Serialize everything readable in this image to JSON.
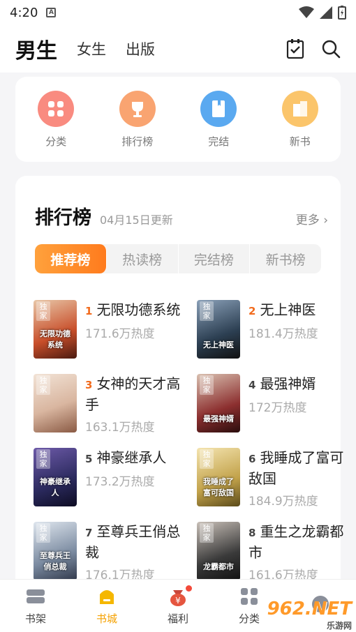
{
  "status_bar": {
    "time": "4:20",
    "notif": "A"
  },
  "header": {
    "tabs": [
      {
        "label": "男生",
        "active": true
      },
      {
        "label": "女生",
        "active": false
      },
      {
        "label": "出版",
        "active": false
      }
    ]
  },
  "categories": [
    {
      "label": "分类",
      "color": "#f98b80"
    },
    {
      "label": "排行榜",
      "color": "#f9a471"
    },
    {
      "label": "完结",
      "color": "#5aa9f0"
    },
    {
      "label": "新书",
      "color": "#fbc56b"
    }
  ],
  "ranking": {
    "title": "排行榜",
    "date": "04月15日更新",
    "more": "更多",
    "tabs": [
      {
        "label": "推荐榜",
        "active": true
      },
      {
        "label": "热读榜",
        "active": false
      },
      {
        "label": "完结榜",
        "active": false
      },
      {
        "label": "新书榜",
        "active": false
      }
    ],
    "books": [
      {
        "rank": "1",
        "name": "无限功德系统",
        "heat": "171.6万热度",
        "cover_tag": "独家",
        "cover_title": "无限功德系统",
        "cover_color": "#c84e2a"
      },
      {
        "rank": "2",
        "name": "无上神医",
        "heat": "181.4万热度",
        "cover_tag": "独家",
        "cover_title": "无上神医",
        "cover_color": "#2c3f52"
      },
      {
        "rank": "3",
        "name": "女神的天才高手",
        "heat": "163.1万热度",
        "cover_tag": "独家",
        "cover_title": "",
        "cover_color": "#d9b6a0"
      },
      {
        "rank": "4",
        "name": "最强神婿",
        "heat": "172万热度",
        "cover_tag": "独家",
        "cover_title": "最强神婿",
        "cover_color": "#8c2f2f"
      },
      {
        "rank": "5",
        "name": "神豪继承人",
        "heat": "173.2万热度",
        "cover_tag": "独家",
        "cover_title": "神豪继承人",
        "cover_color": "#2b2a5e"
      },
      {
        "rank": "6",
        "name": "我睡成了富可敌国",
        "heat": "184.9万热度",
        "cover_tag": "独家",
        "cover_title": "我睡成了富可敌国",
        "cover_color": "#c2a24a"
      },
      {
        "rank": "7",
        "name": "至尊兵王俏总裁",
        "heat": "176.1万热度",
        "cover_tag": "独家",
        "cover_title": "至尊兵王俏总裁",
        "cover_color": "#7a8aa0"
      },
      {
        "rank": "8",
        "name": "重生之龙霸都市",
        "heat": "161.6万热度",
        "cover_tag": "独家",
        "cover_title": "龙霸都市",
        "cover_color": "#3a3a3a"
      }
    ]
  },
  "bottom_nav": [
    {
      "label": "书架",
      "icon": "bookshelf-icon",
      "active": false
    },
    {
      "label": "书城",
      "icon": "bookstore-icon",
      "active": true
    },
    {
      "label": "福利",
      "icon": "gift-icon",
      "active": false
    },
    {
      "label": "分类",
      "icon": "category-icon",
      "active": false
    },
    {
      "label": "",
      "icon": "profile-icon",
      "active": false
    }
  ],
  "watermark": {
    "brand": "962.NET",
    "sub": "乐游网"
  }
}
